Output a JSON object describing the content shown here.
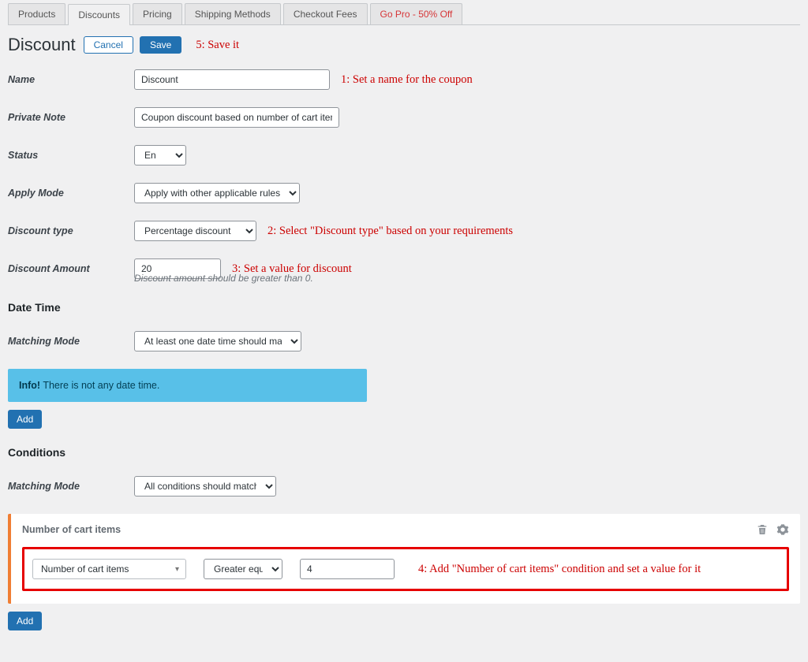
{
  "tabs": {
    "products": "Products",
    "discounts": "Discounts",
    "pricing": "Pricing",
    "shipping": "Shipping Methods",
    "checkout": "Checkout Fees",
    "gopro": "Go Pro - 50% Off"
  },
  "title": "Discount",
  "buttons": {
    "cancel": "Cancel",
    "save": "Save",
    "add": "Add"
  },
  "annotations": {
    "a1": "1: Set a name for the coupon",
    "a2": "2: Select \"Discount type\" based on your requirements",
    "a3": "3: Set a value for discount",
    "a4": "4: Add \"Number of cart items\" condition and set a value for it",
    "a5": "5: Save it"
  },
  "labels": {
    "name": "Name",
    "private_note": "Private Note",
    "status": "Status",
    "apply_mode": "Apply Mode",
    "discount_type": "Discount type",
    "discount_amount": "Discount Amount",
    "date_time": "Date Time",
    "matching_mode": "Matching Mode",
    "conditions": "Conditions"
  },
  "values": {
    "name": "Discount",
    "private_note": "Coupon discount based on number of cart items",
    "status": "Enabled",
    "apply_mode": "Apply with other applicable rules",
    "discount_type": "Percentage discount",
    "discount_amount": "20",
    "discount_amount_hint": "Discount amount should be greater than 0.",
    "dt_matching_mode": "At least one date time should match",
    "cond_matching_mode": "All conditions should match"
  },
  "info": {
    "label": "Info!",
    "text": " There is not any date time."
  },
  "condition": {
    "title": "Number of cart items",
    "field": "Number of cart items",
    "operator": "Greater equal to",
    "value": "4"
  }
}
